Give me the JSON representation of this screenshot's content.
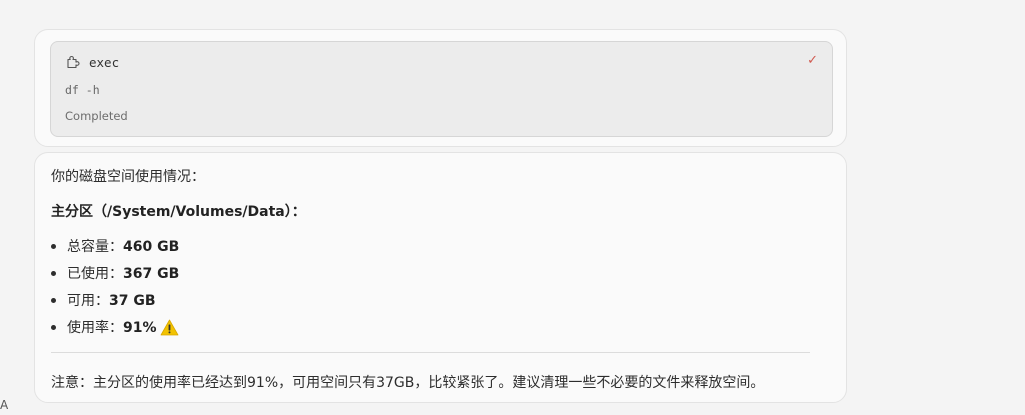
{
  "tool_call": {
    "name": "exec",
    "command": "df -h",
    "status": "Completed",
    "icon": "puzzle-icon",
    "done_icon": "check-icon"
  },
  "message": {
    "intro": "你的磁盘空间使用情况：",
    "heading": "主分区（/System/Volumes/Data）：",
    "stats": [
      {
        "label": "总容量：",
        "value": "460 GB"
      },
      {
        "label": "已使用：",
        "value": "367 GB"
      },
      {
        "label": "可用：",
        "value": "37 GB"
      },
      {
        "label": "使用率：",
        "value": "91%",
        "icon": "warning-icon"
      }
    ],
    "note": "注意：主分区的使用率已经达到91%，可用空间只有37GB，比较紧张了。建议清理一些不必要的文件来释放空间。"
  },
  "colors": {
    "background": "#f4f4f4",
    "card": "#fafafa",
    "tool_inner": "#ececec",
    "check": "#d05a50",
    "warning": "#f2c200"
  }
}
